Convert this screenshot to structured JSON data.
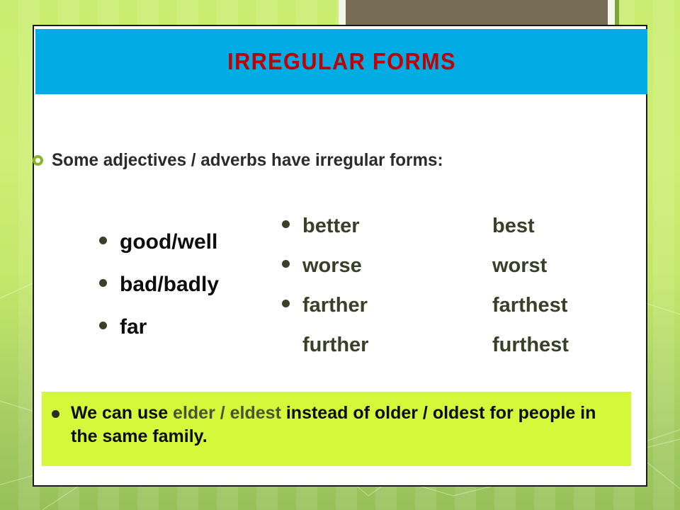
{
  "slide": {
    "title": "IRREGULAR FORMS",
    "intro": "Some adjectives / adverbs have irregular forms:",
    "columns": {
      "base": [
        {
          "label": "good/well",
          "bullet": true
        },
        {
          "label": "bad/badly",
          "bullet": true
        },
        {
          "label": "far",
          "bullet": true
        }
      ],
      "comparative": [
        {
          "label": "better",
          "bullet": true
        },
        {
          "label": "worse",
          "bullet": true
        },
        {
          "label": "farther",
          "bullet": true
        },
        {
          "label": "further",
          "bullet": false
        }
      ],
      "superlative": [
        {
          "label": "best",
          "bullet": false
        },
        {
          "label": "worst",
          "bullet": false
        },
        {
          "label": "farthest",
          "bullet": false
        },
        {
          "label": "furthest",
          "bullet": false
        }
      ]
    },
    "note": {
      "lead": "We can use ",
      "highlight": "elder / eldest",
      "tail": " instead of older / oldest for people in the same family."
    },
    "colors": {
      "title_bar": "#00ace3",
      "title_text": "#c00000",
      "note_box": "#d6f83a",
      "note_highlight_text": "#4e5234",
      "bullet_dark": "#3c4026",
      "ring_bullet": "#8cb426",
      "background_green_top": "#cdef73",
      "background_green_bottom": "#96c159",
      "top_bar_brown": "#766c56"
    }
  }
}
